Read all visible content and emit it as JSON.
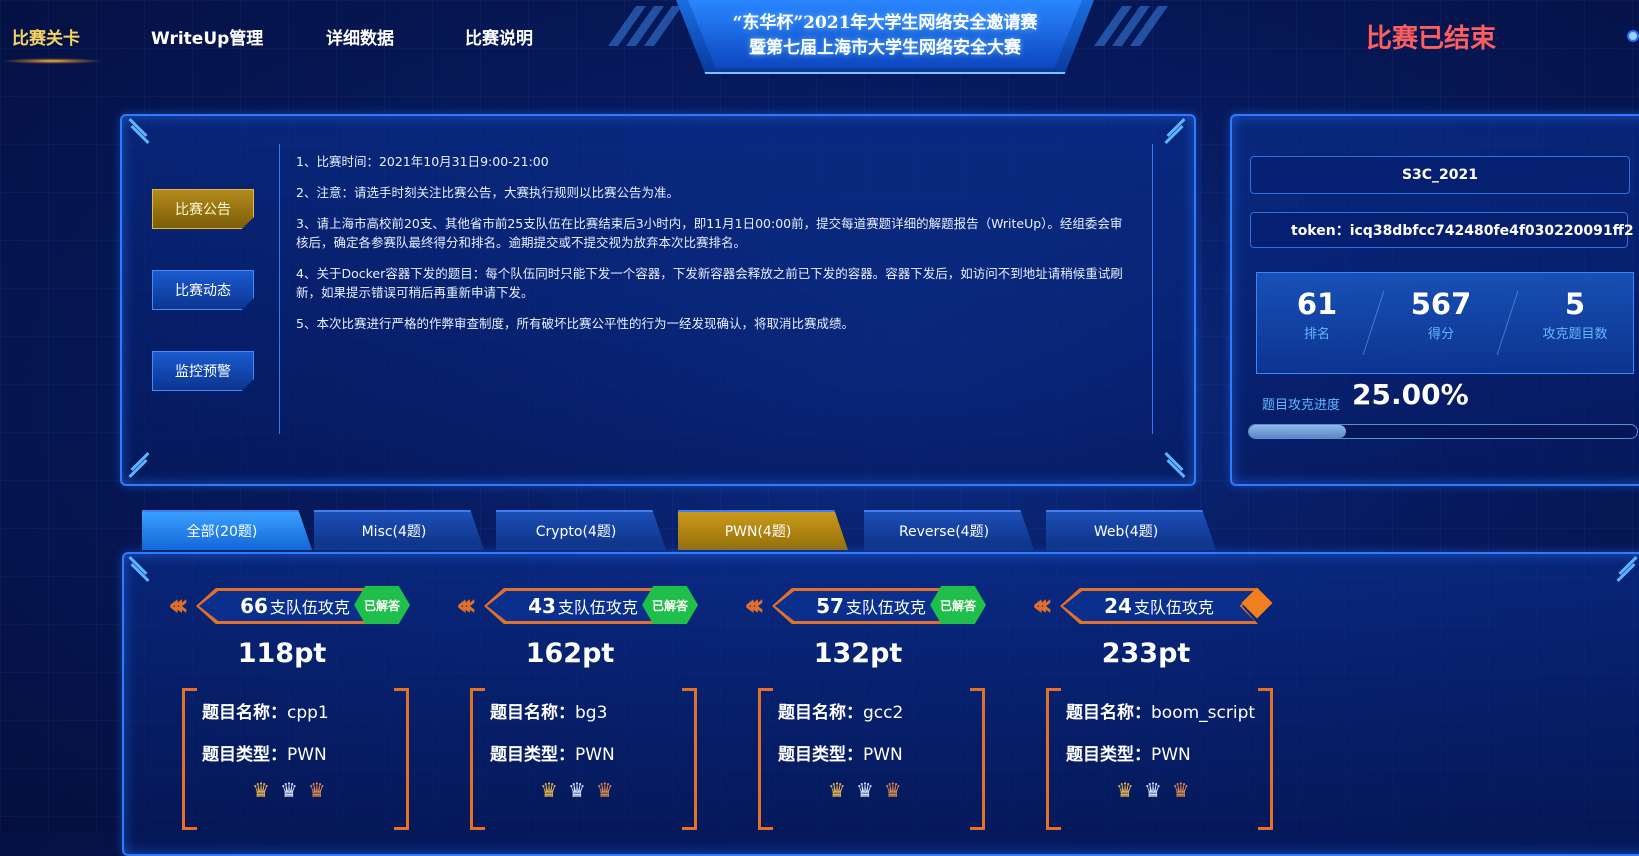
{
  "nav": {
    "items": [
      "比赛关卡",
      "WriteUp管理",
      "详细数据",
      "比赛说明"
    ],
    "active": 0
  },
  "banner": {
    "line1": "“东华杯”2021年大学生网络安全邀请赛",
    "line2": "暨第七届上海市大学生网络安全大赛"
  },
  "status": {
    "text": "比赛已结束",
    "color": "#ff5e5e"
  },
  "sidebar": {
    "buttons": [
      "比赛公告",
      "比赛动态",
      "监控预警"
    ],
    "active": 0
  },
  "notice": {
    "items": [
      "1、比赛时间：2021年10月31日9:00-21:00",
      "2、注意：请选手时刻关注比赛公告，大赛执行规则以比赛公告为准。",
      "3、请上海市高校前20支、其他省市前25支队伍在比赛结束后3小时内，即11月1日00:00前，提交每道赛题详细的解题报告（WriteUp）。经组委会审核后，确定各参赛队最终得分和排名。逾期提交或不提交视为放弃本次比赛排名。",
      "4、关于Docker容器下发的题目：每个队伍同时只能下发一个容器，下发新容器会释放之前已下发的容器。容器下发后，如访问不到地址请稍候重试刷新，如果提示错误可稍后再重新申请下发。",
      "5、本次比赛进行严格的作弊审查制度，所有破坏比赛公平性的行为一经发现确认，将取消比赛成绩。"
    ]
  },
  "team": {
    "name": "S3C_2021",
    "token": "token：icq38dbfcc742480fe4f030220091ff2",
    "stats": [
      {
        "value": "61",
        "label": "排名"
      },
      {
        "value": "567",
        "label": "得分"
      },
      {
        "value": "5",
        "label": "攻克题目数"
      }
    ],
    "progress_label": "题目攻克进度",
    "progress_text": "25.00%",
    "progress_fraction": 0.25
  },
  "tabs": {
    "items": [
      "全部(20题)",
      "Misc(4题)",
      "Crypto(4题)",
      "PWN(4题)",
      "Reverse(4题)",
      "Web(4题)"
    ],
    "active": 0,
    "highlight": 3
  },
  "challenges": [
    {
      "solvers": "66",
      "solvers_suffix": "支队伍攻克",
      "solved_badge": "已解答",
      "solved": true,
      "points": "118pt",
      "name_key": "题目名称：",
      "name": "cpp1",
      "type_key": "题目类型：",
      "type": "PWN",
      "crowns": [
        "♛",
        "♛",
        "♛"
      ]
    },
    {
      "solvers": "43",
      "solvers_suffix": "支队伍攻克",
      "solved_badge": "已解答",
      "solved": true,
      "points": "162pt",
      "name_key": "题目名称：",
      "name": "bg3",
      "type_key": "题目类型：",
      "type": "PWN",
      "crowns": [
        "♛",
        "♛",
        "♛"
      ]
    },
    {
      "solvers": "57",
      "solvers_suffix": "支队伍攻克",
      "solved_badge": "已解答",
      "solved": true,
      "points": "132pt",
      "name_key": "题目名称：",
      "name": "gcc2",
      "type_key": "题目类型：",
      "type": "PWN",
      "crowns": [
        "♛",
        "♛",
        "♛"
      ]
    },
    {
      "solvers": "24",
      "solvers_suffix": "支队伍攻克",
      "solved_badge": "",
      "solved": false,
      "points": "233pt",
      "name_key": "题目名称：",
      "name": "boom_script",
      "type_key": "题目类型：",
      "type": "PWN",
      "crowns": [
        "♛",
        "♛",
        "♛"
      ]
    }
  ],
  "colors": {
    "accent": "#2f7bff",
    "gold": "#f6d365",
    "orange": "#e0702a",
    "green": "#1fbf4a"
  }
}
